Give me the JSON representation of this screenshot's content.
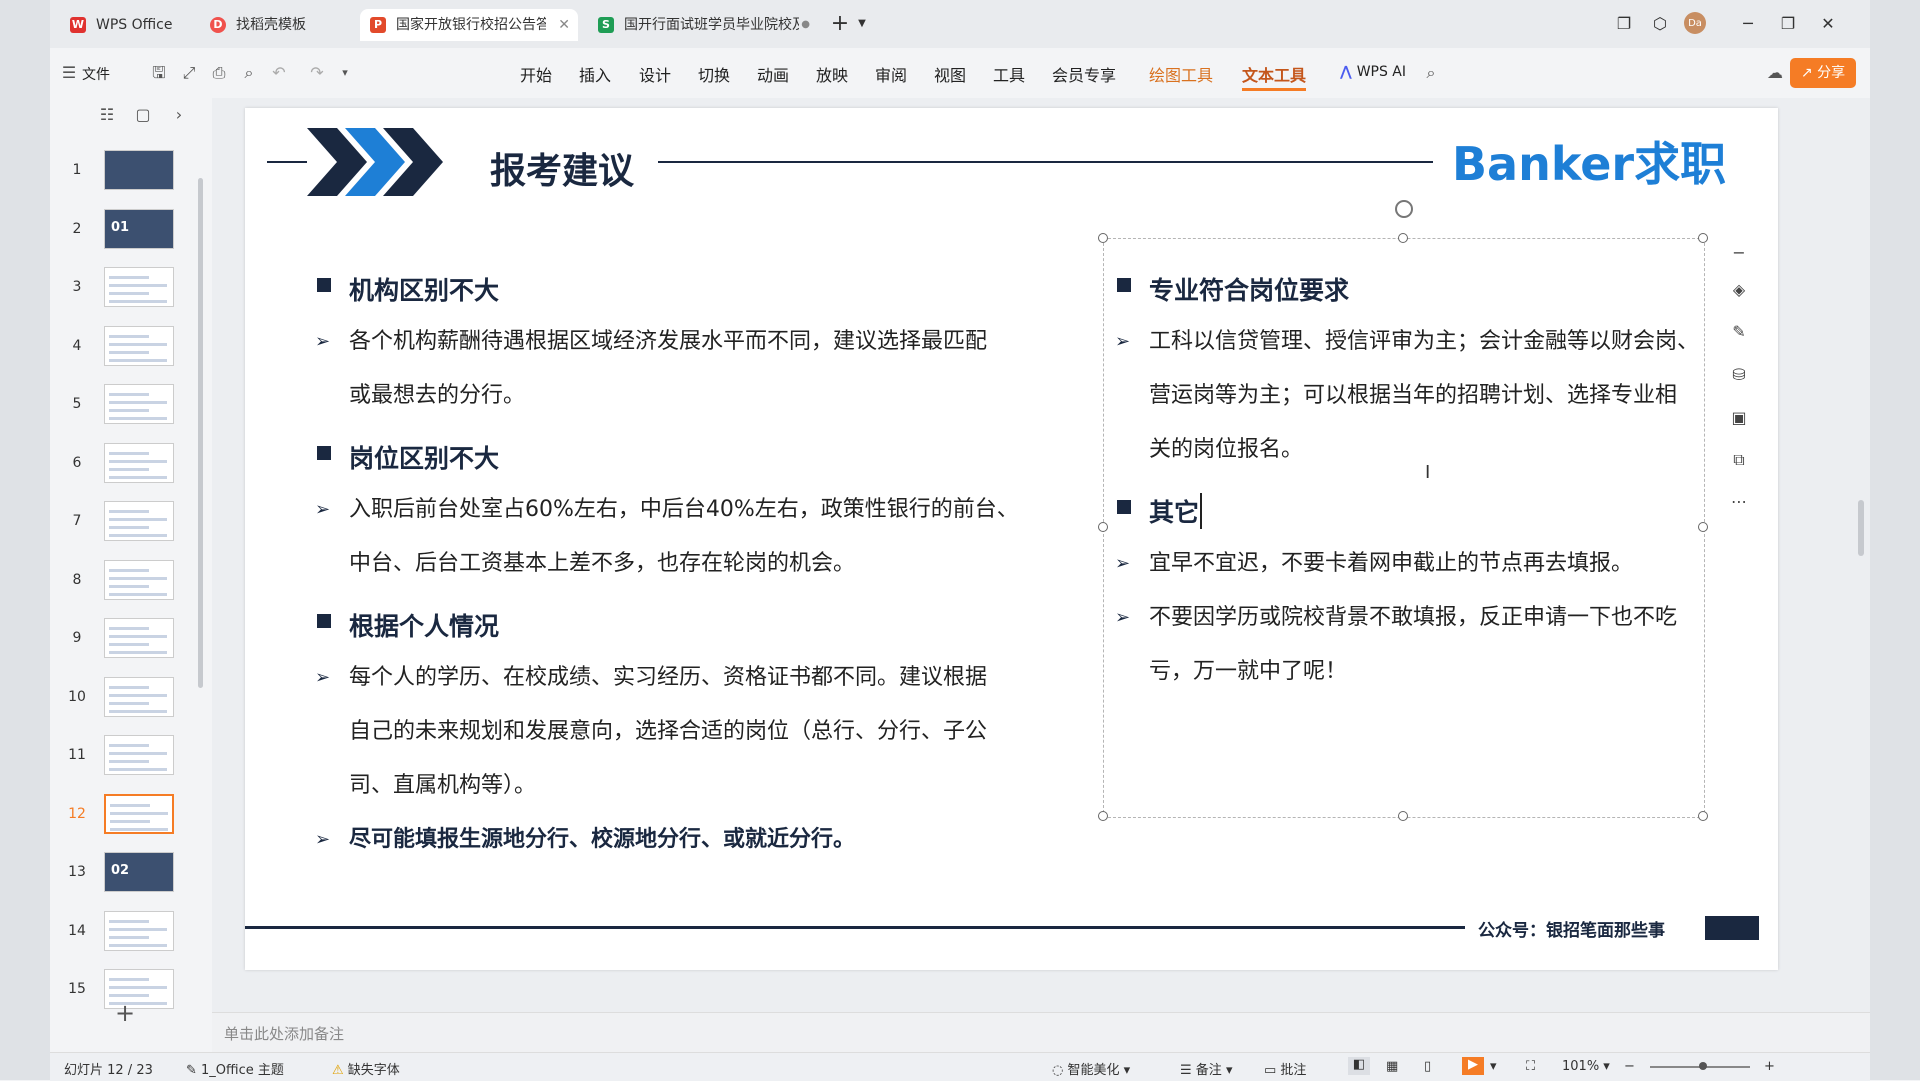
{
  "tabs": [
    {
      "label": "WPS Office",
      "icon": "wps-logo-icon"
    },
    {
      "label": "找稻壳模板",
      "icon": "docer-icon"
    },
    {
      "label": "国家开放银行校招公告答疑（",
      "icon": "presentation-icon"
    },
    {
      "label": "国开行面试班学员毕业院校及专业",
      "icon": "spreadsheet-icon"
    }
  ],
  "toolbar": {
    "file_label": "文件",
    "menus": [
      "开始",
      "插入",
      "设计",
      "切换",
      "动画",
      "放映",
      "审阅",
      "视图",
      "工具",
      "会员专享",
      "绘图工具",
      "文本工具"
    ],
    "wps_ai_label": "WPS AI",
    "share_label": "分享"
  },
  "slides": [
    "1",
    "2",
    "3",
    "4",
    "5",
    "6",
    "7",
    "8",
    "9",
    "10",
    "11",
    "12",
    "13",
    "14",
    "15"
  ],
  "slide_section_labels": {
    "s2": "01",
    "s13": "02"
  },
  "slide": {
    "title": "报考建议",
    "brand": "Banker求职",
    "left": {
      "h1": "机构区别不大",
      "p1a": "各个机构薪酬待遇根据区域经济发展水平而不同，建议选择最匹配",
      "p1b": "或最想去的分行。",
      "h2": "岗位区别不大",
      "p2a": "入职后前台处室占60%左右，中后台40%左右，政策性银行的前台、",
      "p2b": "中台、后台工资基本上差不多，也存在轮岗的机会。",
      "h3": "根据个人情况",
      "p3a": "每个人的学历、在校成绩、实习经历、资格证书都不同。建议根据",
      "p3b": "自己的未来规划和发展意向，选择合适的岗位（总行、分行、子公",
      "p3c": "司、直属机构等）。",
      "p4": "尽可能填报生源地分行、校源地分行、或就近分行。"
    },
    "right": {
      "h1": "专业符合岗位要求",
      "p1a": "工科以信贷管理、授信评审为主；会计金融等以财会岗、",
      "p1b": "营运岗等为主；可以根据当年的招聘计划、选择专业相",
      "p1c": "关的岗位报名。",
      "h2": "其它",
      "p2": "宜早不宜迟，不要卡着网申截止的节点再去填报。",
      "p3a": "不要因学历或院校背景不敢填报，反正申请一下也不吃",
      "p3b": "亏，万一就中了呢！"
    },
    "footer": "公众号：银招笔面那些事"
  },
  "notes_placeholder": "单击此处添加备注",
  "status": {
    "slide_counter": "幻灯片 12 / 23",
    "theme": "1_Office 主题",
    "missing_font": "缺失字体",
    "beautify": "智能美化",
    "notes": "备注",
    "comments": "批注",
    "zoom": "101%"
  },
  "colors": {
    "accent": "#f57c25",
    "navy": "#1a2840",
    "brand_blue": "#1e7fd6"
  }
}
